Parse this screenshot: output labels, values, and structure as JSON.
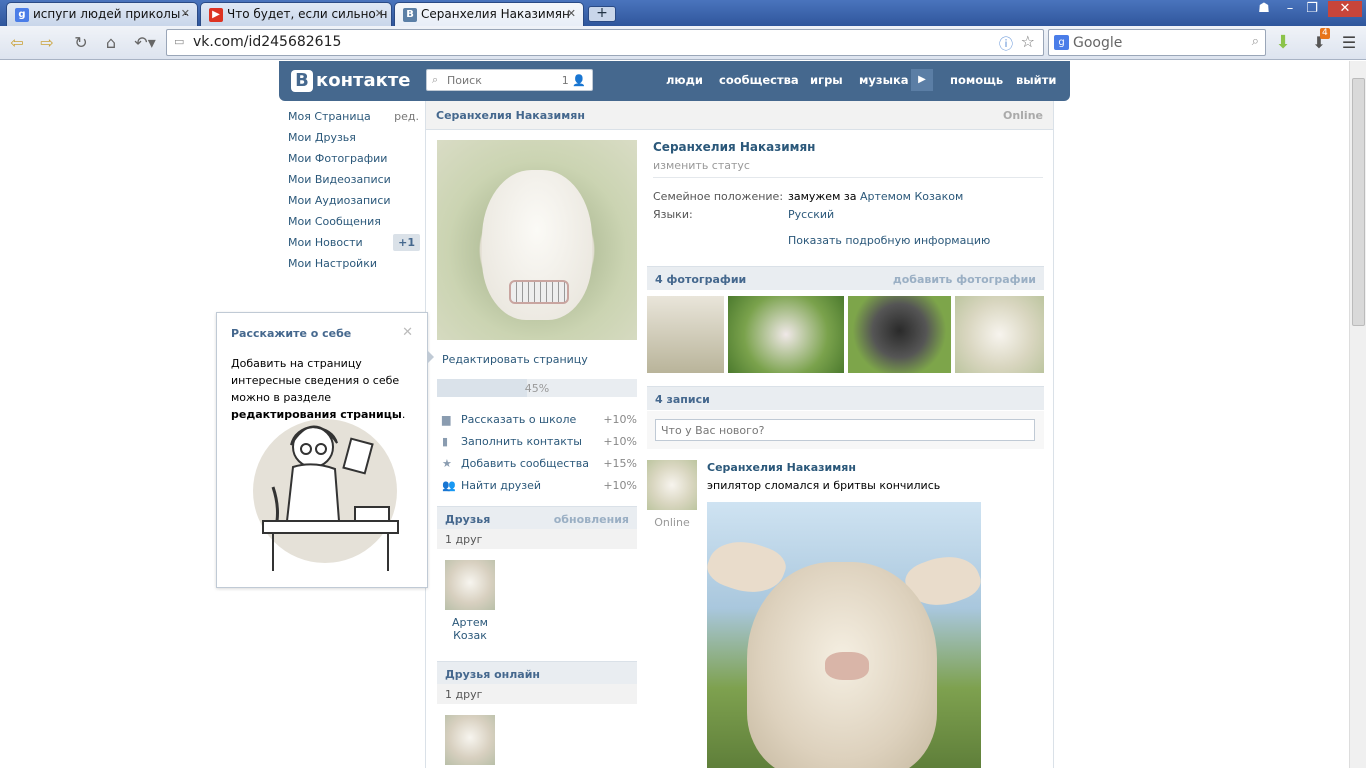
{
  "browser": {
    "tabs": [
      {
        "title": "испуги людей приколы -",
        "icon": "google-icon"
      },
      {
        "title": "Что будет, если сильно н",
        "icon": "youtube-icon"
      },
      {
        "title": "Серанхелия Наказимян",
        "icon": "vk-icon"
      }
    ],
    "url": "vk.com/id245682615",
    "search_engine": "Google",
    "downloads_badge": "4"
  },
  "vk": {
    "logo": "контакте",
    "logo_letter": "В",
    "search_placeholder": "Поиск",
    "search_count": "1",
    "top_nav": [
      "люди",
      "сообщества",
      "игры",
      "музыка",
      "помощь",
      "выйти"
    ],
    "left_menu": [
      {
        "label": "Моя Страница",
        "extra": "ред."
      },
      {
        "label": "Мои Друзья"
      },
      {
        "label": "Мои Фотографии"
      },
      {
        "label": "Мои Видеозаписи"
      },
      {
        "label": "Мои Аудиозаписи"
      },
      {
        "label": "Мои Сообщения"
      },
      {
        "label": "Мои Новости",
        "badge": "+1"
      },
      {
        "label": "Мои Настройки"
      }
    ],
    "header_name": "Серанхелия Наказимян",
    "header_status": "Online",
    "profile": {
      "name": "Серанхелия Наказимян",
      "status": "изменить статус",
      "family_label": "Семейное положение:",
      "family_value": "замужем за",
      "family_link": "Артемом Козаком",
      "lang_label": "Языки:",
      "lang_value": "Русский",
      "show_more": "Показать подробную информацию"
    },
    "edit_page": "Редактировать страницу",
    "progress": {
      "percent": 45,
      "label": "45%"
    },
    "tasks": [
      {
        "label": "Рассказать о школе",
        "pct": "+10%",
        "icon": "school-icon"
      },
      {
        "label": "Заполнить контакты",
        "pct": "+10%",
        "icon": "phone-icon"
      },
      {
        "label": "Добавить сообщества",
        "pct": "+15%",
        "icon": "star-icon"
      },
      {
        "label": "Найти друзей",
        "pct": "+10%",
        "icon": "people-icon"
      }
    ],
    "friends": {
      "title": "Друзья",
      "action": "обновления",
      "count": "1 друг",
      "items": [
        {
          "name": "Артем Козак"
        }
      ]
    },
    "friends_online": {
      "title": "Друзья онлайн",
      "count": "1 друг"
    },
    "photos": {
      "title": "4 фотографии",
      "action": "добавить фотографии"
    },
    "wall": {
      "title": "4 записи",
      "placeholder": "Что у Вас нового?",
      "post": {
        "author": "Серанхелия Наказимян",
        "text": "эпилятор сломался и бритвы кончились",
        "online": "Online"
      }
    },
    "tooltip": {
      "title": "Расскажите о себе",
      "text": "Добавить на страницу интересные сведения о себе можно в разделе",
      "bold": "редактирования страницы",
      "tail": "."
    }
  }
}
